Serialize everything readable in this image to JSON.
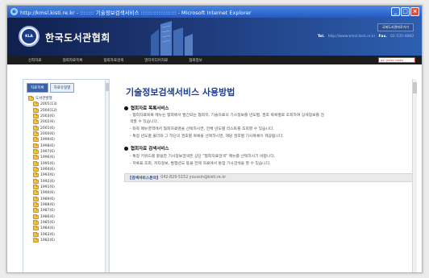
{
  "window": {
    "title": "http://kmsl.kisti.re.kr - :::::::: 기술정보검색서비스 :::::::::::::::::::: - Microsoft Internet Explorer",
    "ie_icon": "e",
    "minimize": "_",
    "maximize": "□",
    "close": "×"
  },
  "header": {
    "logo_text": "KLA",
    "site_name": "한국도서관협회",
    "shortcut_label": "국회도서관바로가기",
    "tel_label": "Tel.",
    "tel_value": "http://www.kmsl.kisti.re.kr",
    "fax_label": "Fax.",
    "fax_value": "02-535-4860"
  },
  "nav": {
    "items": [
      "신착자료",
      "협회자료목록",
      "협회자료검색",
      "멀티미디어자료",
      "협회정보"
    ],
    "search_placeholder": "go! press media"
  },
  "sidebar": {
    "tabs": [
      "자료목록",
      "자료유형별"
    ],
    "tree_root": "도서관발행",
    "items": [
      "2005(13)",
      "2004(12)",
      "2003(6)",
      "2002(6)",
      "2001(6)",
      "2000(6)",
      "1999(6)",
      "1998(6)",
      "1997(6)",
      "1996(6)",
      "1995(6)",
      "1994(6)",
      "1993(6)",
      "1992(6)",
      "1991(6)",
      "1990(6)",
      "1989(6)",
      "1988(6)",
      "1987(6)",
      "1986(6)",
      "1985(6)",
      "1984(6)",
      "1983(6)",
      "1982(6)"
    ]
  },
  "main": {
    "title": "기술정보검색서비스 사용방법",
    "section1": {
      "heading": "협회자료 목록서비스",
      "lines": [
        "- 협회자료목록 메뉴는 협회에서 발간되는 협회지, 기술자료의 기사정보를 년도별, 권호 목록별로 조회하여 상세정보를 검",
        "  색할 수 있습니다.",
        "- 좌측 메뉴영역에서 협회자료명을 선택하시면, 전체 년도별 리스트를 조회할 수 있습니다.",
        "- 특정 년도별 폴더와 그 하단의 권호별 목록을 선택하시면, 해당 권호별 기사목록이 제공됩니다."
      ]
    },
    "section2": {
      "heading": "협회자료 검색서비스",
      "lines": [
        "- 특정 키워드를 활용한 기사정보검색은 상단 \"협회자료검색\" 메뉴를 선택하시기 바랍니다.",
        "- 저록표 조회, 저자정보, 발행년도 등을 전제 자료에서 통합 기사검색을 할 수 있습니다."
      ]
    },
    "contact": {
      "label": "[검색서비스문의]",
      "text": "042-829-5152 youssin@kisti.re.kr"
    }
  }
}
